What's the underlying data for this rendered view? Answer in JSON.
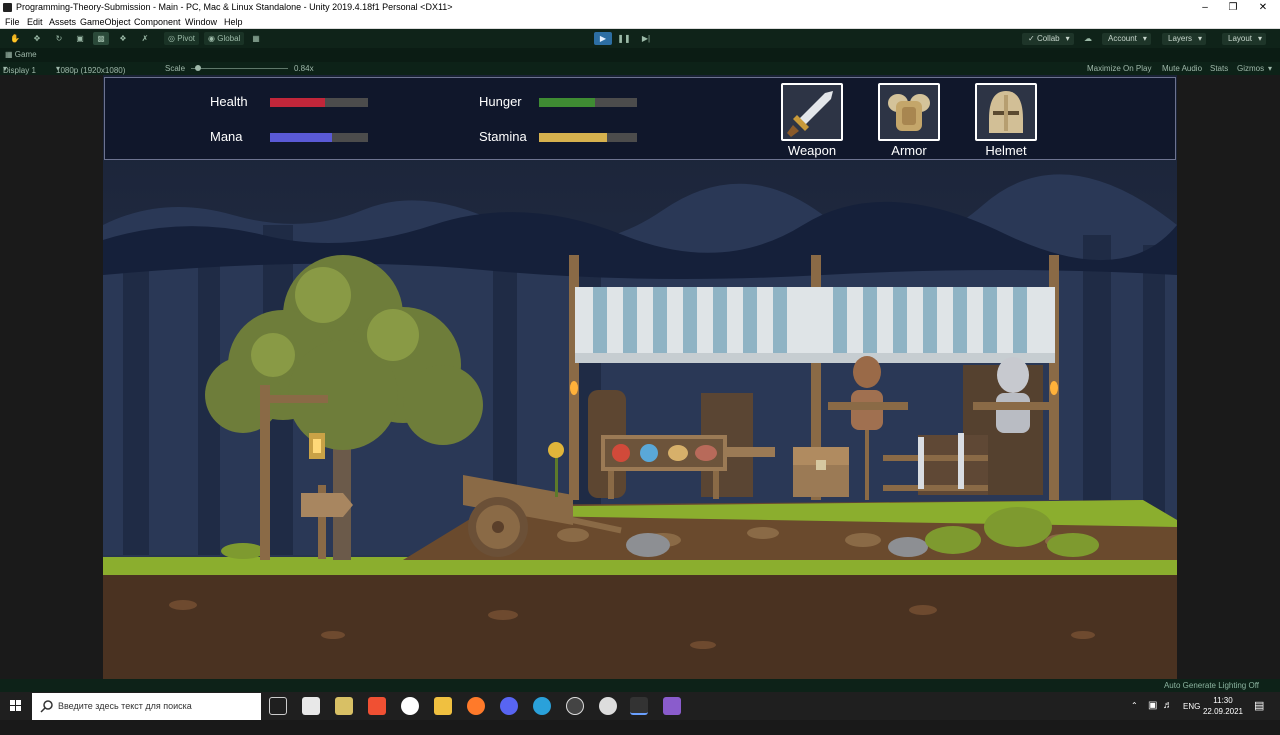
{
  "window": {
    "title": "Programming-Theory-Submission - Main - PC, Mac & Linux Standalone - Unity 2019.4.18f1 Personal <DX11>"
  },
  "menu": [
    "File",
    "Edit",
    "Assets",
    "GameObject",
    "Component",
    "Window",
    "Help"
  ],
  "toolbar": {
    "pivot_label": "Pivot",
    "global_label": "Global",
    "collab_label": "Collab",
    "account_label": "Account",
    "layers_label": "Layers",
    "layout_label": "Layout"
  },
  "game_tab": {
    "label": "Game",
    "display": "Display 1",
    "resolution": "1080p (1920x1080)",
    "scale_label": "Scale",
    "scale_value": "0.84x",
    "scale_fraction": 0.05,
    "maximize_on_play": "Maximize On Play",
    "mute_audio": "Mute Audio",
    "stats": "Stats",
    "gizmos": "Gizmos"
  },
  "hud": {
    "stats": [
      {
        "label": "Health",
        "fill": 0.56,
        "color": "#c1263a"
      },
      {
        "label": "Mana",
        "fill": 0.63,
        "color": "#5a5ad6"
      },
      {
        "label": "Hunger",
        "fill": 0.57,
        "color": "#3f8c33"
      },
      {
        "label": "Stamina",
        "fill": 0.69,
        "color": "#d6b14e"
      }
    ],
    "equipment": [
      {
        "label": "Weapon",
        "icon": "sword-icon"
      },
      {
        "label": "Armor",
        "icon": "armor-icon"
      },
      {
        "label": "Helmet",
        "icon": "helmet-icon"
      }
    ]
  },
  "status_line": "Auto Generate Lighting Off",
  "taskbar": {
    "search_placeholder": "Введите здесь текст для поиска",
    "lang": "ENG",
    "time": "11:30",
    "date": "22.09.2021"
  }
}
